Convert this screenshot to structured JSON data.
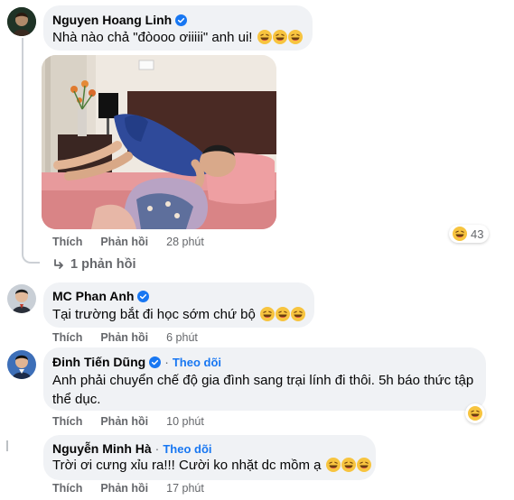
{
  "comments": [
    {
      "author": "Nguyen Hoang Linh",
      "text": "Nhà nào chả \"đòooo ơiiiii\" anh ui!",
      "emoji_count": 3,
      "like_label": "Thích",
      "reply_label": "Phản hồi",
      "time": "28 phút",
      "reaction_count": "43",
      "replies_label": "1 phản hồi"
    },
    {
      "author": "MC Phan Anh",
      "text": "Tại trường bắt đi học sớm chứ bộ",
      "emoji_count": 3,
      "like_label": "Thích",
      "reply_label": "Phản hồi",
      "time": "6 phút"
    },
    {
      "author": "Đinh Tiến Dũng",
      "follow_label": "Theo dõi",
      "text": "Anh phải chuyển chế độ gia đình sang trại lính đi thôi. 5h báo thức tập thể dục.",
      "like_label": "Thích",
      "reply_label": "Phản hồi",
      "time": "10 phút"
    },
    {
      "author": "Nguyễn Minh Hà",
      "follow_label": "Theo dõi",
      "text": "Trời ơi cưng xỉu ra!!! Cười ko nhặt dc mồm ạ",
      "emoji_count": 3,
      "like_label": "Thích",
      "reply_label": "Phản hồi",
      "time": "17 phút"
    }
  ],
  "icons": {
    "verified": "verified-badge-icon",
    "laugh": "laughing-emoji-icon",
    "reply_arrow": "reply-arrow-icon"
  },
  "colors": {
    "bubble": "#f0f2f5",
    "verified": "#1877f2",
    "follow": "#1877f2",
    "meta": "#65676b"
  }
}
